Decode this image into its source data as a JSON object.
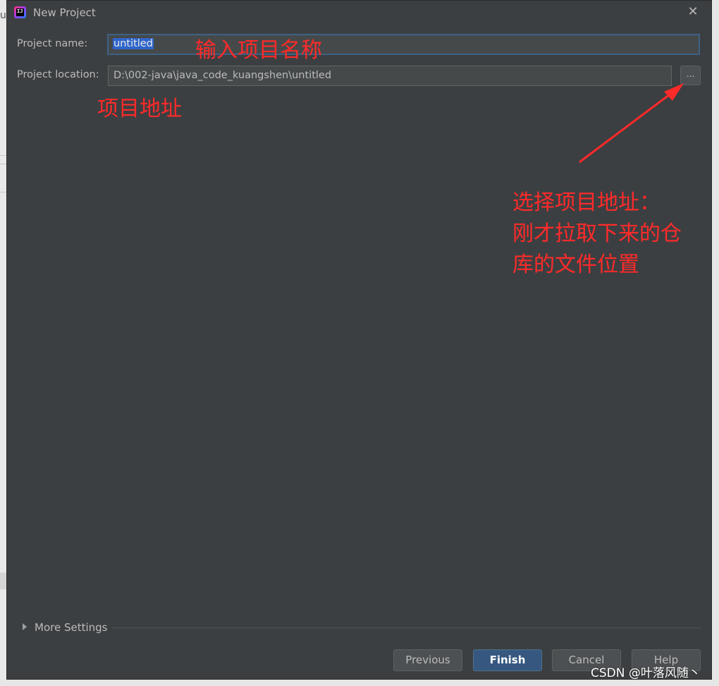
{
  "dialog": {
    "title": "New Project",
    "close_glyph": "✕",
    "app_icon_letters": "IJ"
  },
  "form": {
    "name_label": "Project name:",
    "name_value": "untitled",
    "location_label": "Project location:",
    "location_value": "D:\\002-java\\java_code_kuangshen\\untitled",
    "browse_label": "..."
  },
  "more_settings": "More Settings",
  "buttons": {
    "previous": "Previous",
    "finish": "Finish",
    "cancel": "Cancel",
    "help": "Help"
  },
  "annotations": {
    "name_note": "输入项目名称",
    "location_note": "项目地址",
    "browse_note_line1": "选择项目地址：",
    "browse_note_line2": "刚才拉取下来的仓",
    "browse_note_line3": "库的文件位置"
  },
  "watermark": "CSDN @叶落风随丶",
  "background_edge_text": "u",
  "colors": {
    "dialog_bg": "#3c3f41",
    "annotation": "#ff2a2a",
    "primary_button": "#365880",
    "focus_border": "#3d6185",
    "selection": "#2f65ca"
  },
  "icons": [
    "intellij-app-icon",
    "close-icon",
    "expand-triangle-icon",
    "annotation-arrow-icon"
  ]
}
